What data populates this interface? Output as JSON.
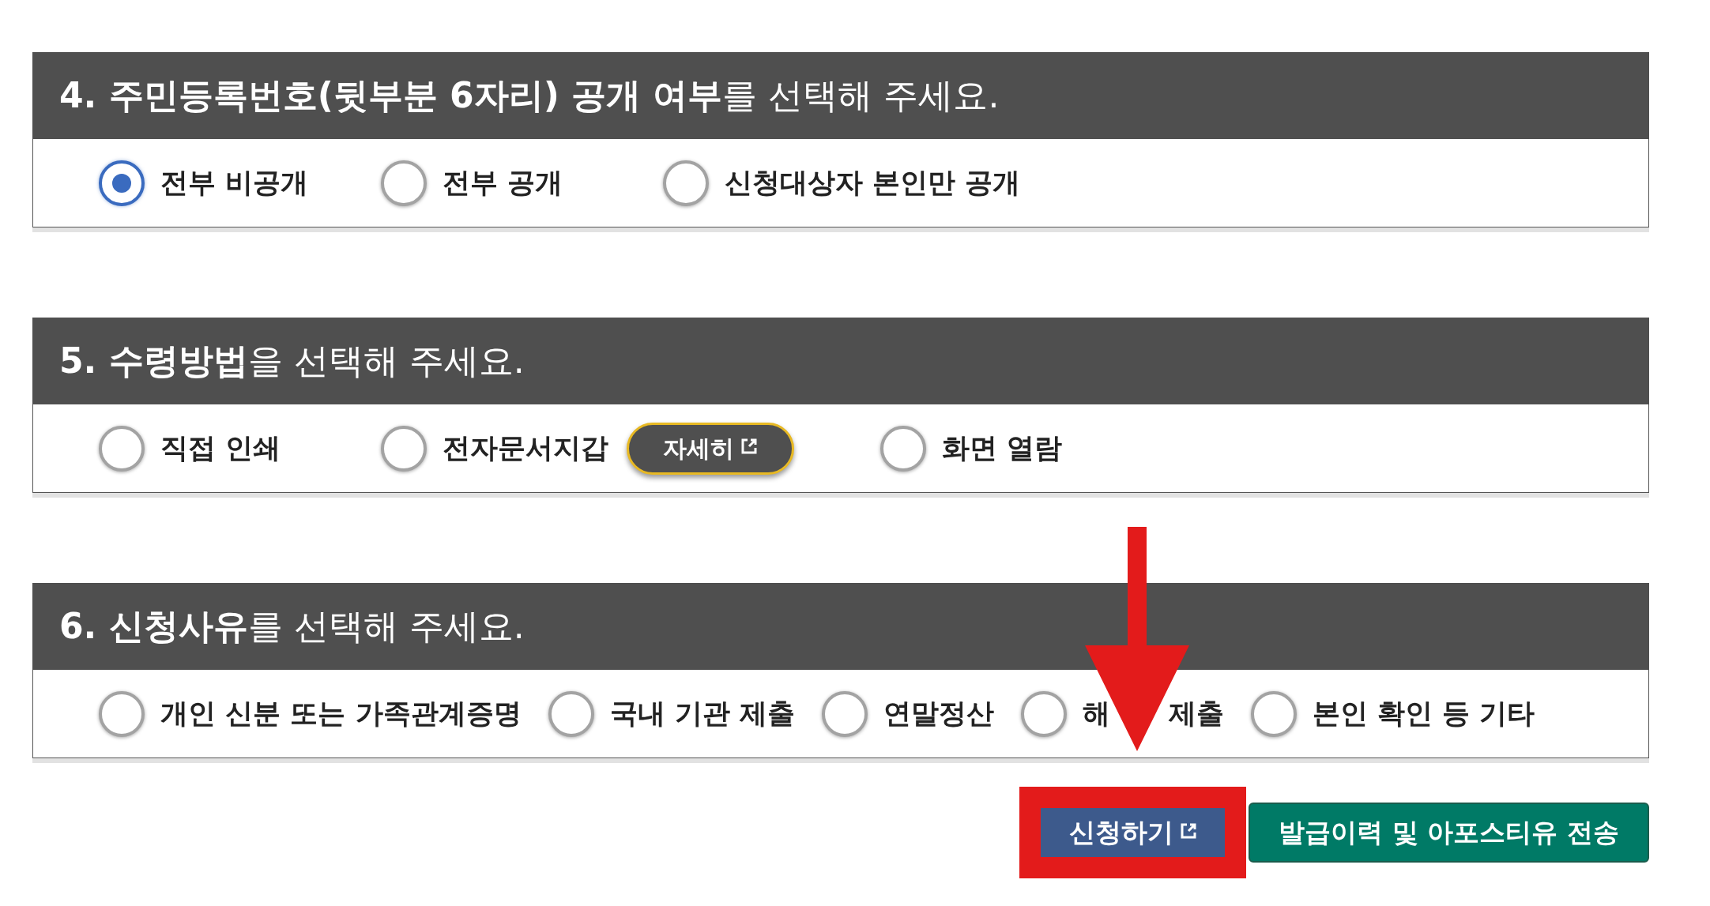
{
  "sections": [
    {
      "title": "**4. 주민등록번호(뒷부분 6자리) 공개 여부**를 선택해 주세요.",
      "kind": "grid",
      "options": [
        {
          "kind": "radio",
          "label": "전부 비공개",
          "selected": true
        },
        {
          "kind": "radio",
          "label": "전부 공개",
          "selected": false
        },
        {
          "kind": "radio",
          "label": "신청대상자 본인만 공개",
          "selected": false
        }
      ]
    },
    {
      "title": "**5. 수령방법**을 선택해 주세요.",
      "kind": "grid",
      "options": [
        {
          "kind": "radio",
          "label": "직접 인쇄",
          "selected": false
        },
        {
          "kind": "radio",
          "label": "전자문서지갑",
          "selected": false
        },
        {
          "kind": "link",
          "label": "자세히"
        },
        {
          "kind": "radio",
          "label": "화면 열람",
          "selected": false
        }
      ]
    },
    {
      "title": "**6. 신청사유**를 선택해 주세요.",
      "kind": "flow",
      "options": [
        {
          "kind": "radio",
          "label": "개인 신분 또는 가족관계증명",
          "selected": false
        },
        {
          "kind": "radio",
          "label": "국내 기관 제출",
          "selected": false
        },
        {
          "kind": "radio",
          "label": "연말정산",
          "selected": false
        },
        {
          "kind": "radio",
          "label_parts": [
            "해",
            "제출"
          ],
          "selected": false
        },
        {
          "kind": "radio",
          "label": "본인 확인 등 기타",
          "selected": false
        }
      ]
    }
  ],
  "buttons": [
    {
      "kind": "primary",
      "label": "신청하기",
      "highlighted": true
    },
    {
      "kind": "secondary",
      "label": "발급이력 및 아포스티유 전송",
      "highlighted": false
    }
  ]
}
